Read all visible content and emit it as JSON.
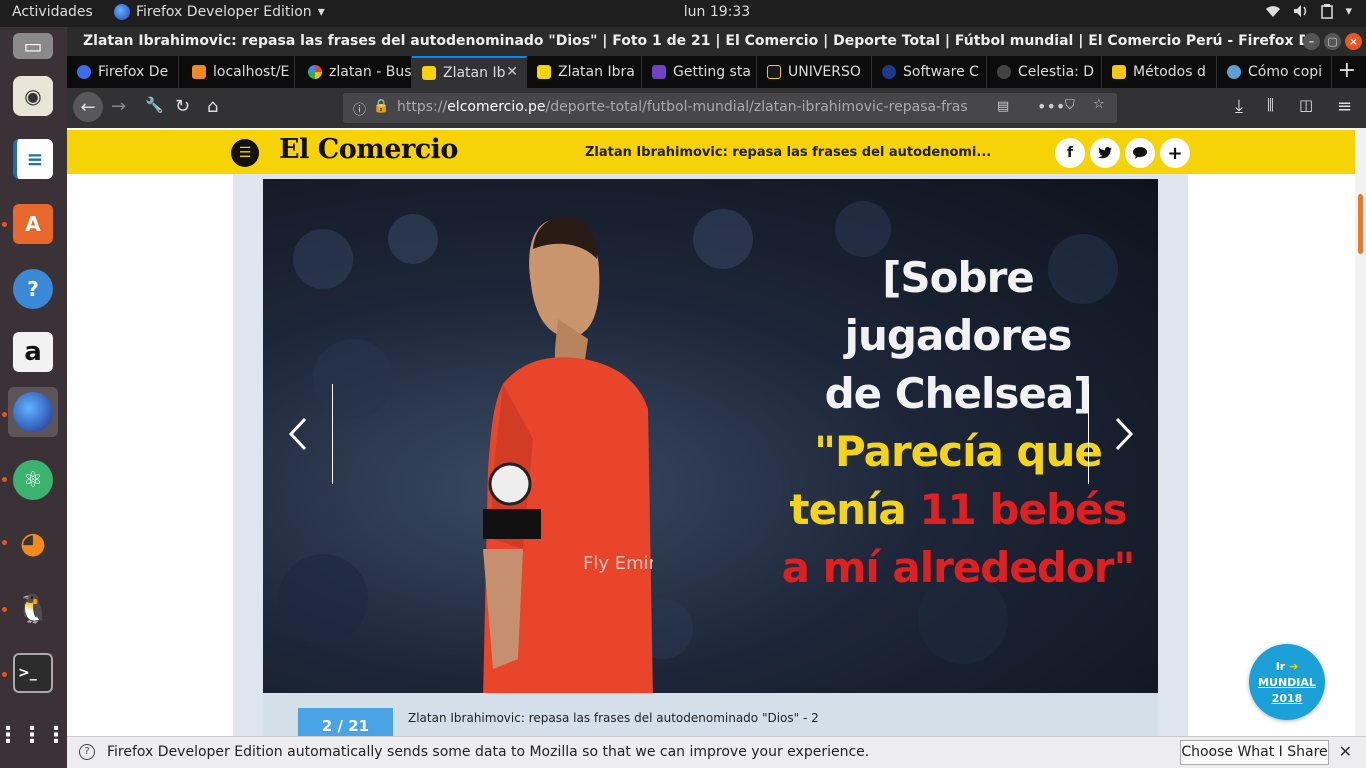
{
  "topbar": {
    "activities": "Actividades",
    "app_name": "Firefox Developer Edition",
    "clock": "lun 19:33"
  },
  "dock": {
    "items": [
      {
        "name": "files-icon"
      },
      {
        "name": "rhythmbox-icon"
      },
      {
        "name": "libreoffice-writer-icon"
      },
      {
        "name": "software-center-icon"
      },
      {
        "name": "help-icon"
      },
      {
        "name": "amazon-icon"
      },
      {
        "name": "firefox-icon"
      },
      {
        "name": "atom-icon"
      },
      {
        "name": "blender-icon"
      },
      {
        "name": "supertux-icon"
      },
      {
        "name": "terminal-icon"
      },
      {
        "name": "show-apps-icon"
      }
    ]
  },
  "window": {
    "title": "Zlatan Ibrahimovic: repasa las frases del autodenominado \"Dios\" | Foto 1 de 21 | El Comercio | Deporte Total | Fútbol mundial | El Comercio Perú - Firefox Developer Edition"
  },
  "tabs": [
    {
      "label": "Firefox De",
      "color": "#3b6ee8"
    },
    {
      "label": "localhost/E",
      "color": "#f08a24"
    },
    {
      "label": "zlatan - Bus",
      "color": "#ffffff"
    },
    {
      "label": "Zlatan Ib",
      "color": "#f6d306"
    },
    {
      "label": "Zlatan Ibra",
      "color": "#f6d306"
    },
    {
      "label": "Getting sta",
      "color": "#6f42c1"
    },
    {
      "label": "UNIVERSO",
      "color": "#1a1a1a"
    },
    {
      "label": "Software C",
      "color": "#1d3a8a"
    },
    {
      "label": "Celestia: D",
      "color": "#444444"
    },
    {
      "label": "Métodos d",
      "color": "#f5c518"
    },
    {
      "label": "Cómo copi",
      "color": "#5ca0d3"
    }
  ],
  "nav": {
    "url_scheme": "https://",
    "url_host": "elcomercio.pe",
    "url_path": "/deporte-total/futbol-mundial/zlatan-ibrahimovic-repasa-fras"
  },
  "site": {
    "logo": "El Comercio",
    "bar_headline": "Zlatan Ibrahimovic: repasa las frases del autodenomi...",
    "share_buttons": [
      {
        "name": "facebook-share-button",
        "glyph": "f"
      },
      {
        "name": "twitter-share-button",
        "glyph": "🐦"
      },
      {
        "name": "comment-button",
        "glyph": "💬"
      },
      {
        "name": "more-share-button",
        "glyph": "+"
      }
    ]
  },
  "gallery": {
    "quote_line1": "[Sobre jugadores",
    "quote_line2": "de Chelsea]",
    "quote_line3": "\"Parecía que",
    "quote_line4a": "tenía ",
    "quote_line4b": "11 bebés",
    "quote_line5": "a mí alrededor\"",
    "shirt_text": "Fly Emira",
    "counter": "2 / 21",
    "caption": "Zlatan Ibrahimovic: repasa las frases del autodenominado \"Dios\" - 2"
  },
  "mundial": {
    "ir": "Ir",
    "label1": "MUNDIAL",
    "label2": "2018"
  },
  "notification": {
    "text": "Firefox Developer Edition automatically sends some data to Mozilla so that we can improve your experience.",
    "button": "Choose What I Share"
  }
}
